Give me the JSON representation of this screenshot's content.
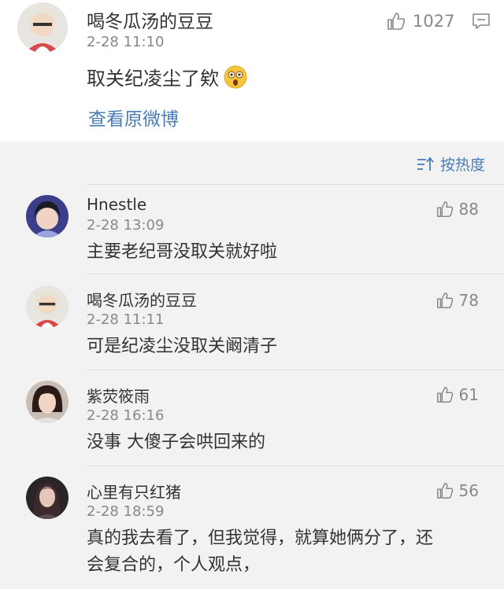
{
  "top_comment": {
    "username": "喝冬瓜汤的豆豆",
    "time": "2-28 11:10",
    "content": "取关纪凌尘了欸",
    "likes": "1027",
    "view_original": "查看原微博"
  },
  "sort": {
    "label": "按热度"
  },
  "replies": [
    {
      "username": "Hnestle",
      "time": "2-28 13:09",
      "content": "主要老纪哥没取关就好啦",
      "likes": "88"
    },
    {
      "username": "喝冬瓜汤的豆豆",
      "time": "2-28 11:11",
      "content": "可是纪凌尘没取关阚清子",
      "likes": "78"
    },
    {
      "username": "紫荧筱雨",
      "time": "2-28 16:16",
      "content": "没事 大傻子会哄回来的",
      "likes": "61"
    },
    {
      "username": "心里有只红猪",
      "time": "2-28 18:59",
      "content_line1": "真的我去看了，但我觉得，就算她俩分了，还",
      "content_line2": "会复合的，个人观点，",
      "likes": "56"
    }
  ],
  "colors": {
    "link": "#4a7cb5",
    "muted": "#888888",
    "background": "#f2f2f2"
  }
}
